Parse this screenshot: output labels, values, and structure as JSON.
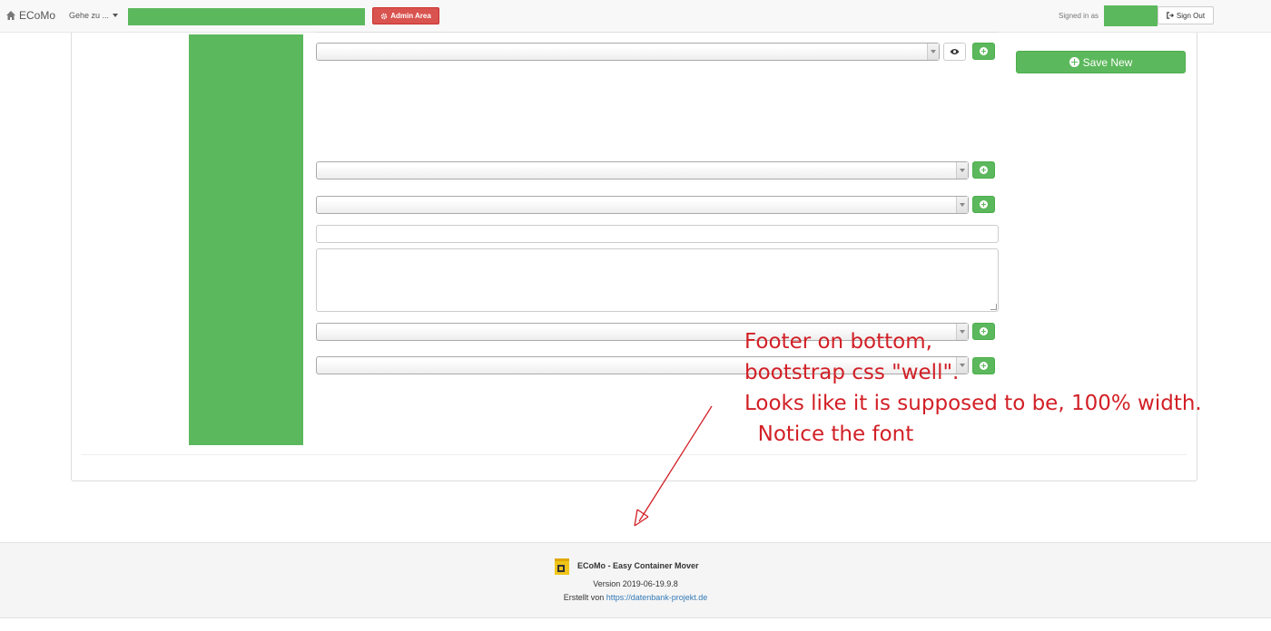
{
  "navbar": {
    "brand": "ECoMo",
    "goto_label": "Gehe zu ...",
    "admin_label": "Admin Area",
    "signed_in_label": "Signed in as",
    "signout_label": "Sign Out"
  },
  "form": {
    "save_new_label": "Save New"
  },
  "annotation": {
    "text": "Footer on bottom,\nbootstrap css \"well\".\nLooks like it is supposed to be, 100% width.\n  Notice the font",
    "color": "#d21f26"
  },
  "footer": {
    "title": "ECoMo - Easy Container Mover",
    "version": "Version 2019-06-19.9.8",
    "created_prefix": "Erstellt von ",
    "created_link": "https://datenbank-projekt.de"
  },
  "colors": {
    "green": "#5cb85c",
    "danger": "#d9534f",
    "link": "#337ab7"
  }
}
